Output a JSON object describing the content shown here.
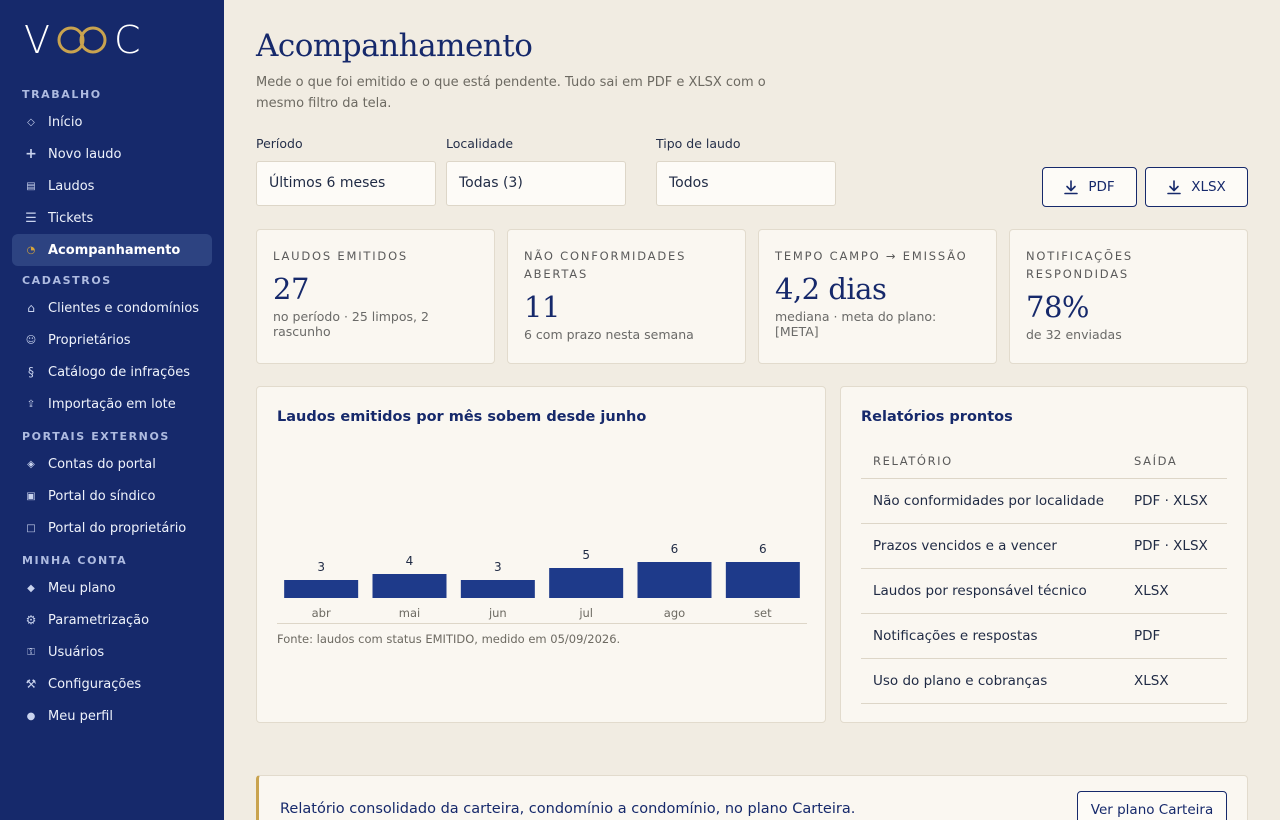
{
  "brand": {
    "logo_text_left": "V",
    "logo_text_right": "C"
  },
  "colors": {
    "navy": "#16296b",
    "gold": "#c9a34f",
    "bar": "#1e3a8a",
    "background": "#f1ece2",
    "card": "#faf7f1"
  },
  "sidebar": {
    "sections": [
      {
        "title": "TRABALHO",
        "items": [
          {
            "label": "Início",
            "icon": "home-diamond-icon"
          },
          {
            "label": "Novo laudo",
            "icon": "plus-icon"
          },
          {
            "label": "Laudos",
            "icon": "document-list-icon"
          },
          {
            "label": "Tickets",
            "icon": "lines-icon"
          },
          {
            "label": "Acompanhamento",
            "icon": "chart-pie-icon",
            "active": true
          }
        ]
      },
      {
        "title": "CADASTROS",
        "items": [
          {
            "label": "Clientes e condomínios",
            "icon": "house-icon"
          },
          {
            "label": "Proprietários",
            "icon": "person-icon"
          },
          {
            "label": "Catálogo de infrações",
            "icon": "section-icon"
          },
          {
            "label": "Importação em lote",
            "icon": "upload-icon"
          }
        ]
      },
      {
        "title": "PORTAIS EXTERNOS",
        "items": [
          {
            "label": "Contas do portal",
            "icon": "diamond-icon"
          },
          {
            "label": "Portal do síndico",
            "icon": "square-filled-icon"
          },
          {
            "label": "Portal do proprietário",
            "icon": "square-outline-icon"
          }
        ]
      },
      {
        "title": "MINHA CONTA",
        "items": [
          {
            "label": "Meu plano",
            "icon": "diamond-solid-icon"
          },
          {
            "label": "Parametrização",
            "icon": "gear-icon"
          },
          {
            "label": "Usuários",
            "icon": "users-icon"
          },
          {
            "label": "Configurações",
            "icon": "tools-icon"
          },
          {
            "label": "Meu perfil",
            "icon": "profile-dot-icon"
          }
        ]
      }
    ]
  },
  "header": {
    "title": "Acompanhamento",
    "subtitle": "Mede o que foi emitido e o que está pendente. Tudo sai em PDF e XLSX com o mesmo filtro da tela."
  },
  "filters": {
    "periodo": {
      "label": "Período",
      "value": "Últimos 6 meses"
    },
    "localidade": {
      "label": "Localidade",
      "value": "Todas (3)"
    },
    "tipo": {
      "label": "Tipo de laudo",
      "value": "Todos"
    }
  },
  "export": {
    "pdf_label": "PDF",
    "xlsx_label": "XLSX"
  },
  "kpis": [
    {
      "label": "Laudos emitidos",
      "value": "27",
      "note": "no período · 25 limpos, 2 rascunho"
    },
    {
      "label": "Não conformidades abertas",
      "value": "11",
      "note": "6 com prazo nesta semana"
    },
    {
      "label": "Tempo campo → emissão",
      "value": "4,2 dias",
      "note": "mediana · meta do plano: [META]"
    },
    {
      "label": "Notificações respondidas",
      "value": "78%",
      "note": "de 32 enviadas"
    }
  ],
  "chart_panel": {
    "title": "Laudos emitidos por mês sobem desde junho",
    "source": "Fonte: laudos com status EMITIDO, medido em 05/09/2026."
  },
  "chart_data": {
    "type": "bar",
    "title": "Laudos emitidos por mês sobem desde junho",
    "categories": [
      "abr",
      "mai",
      "jun",
      "jul",
      "ago",
      "set"
    ],
    "values": [
      3,
      4,
      3,
      5,
      6,
      6
    ],
    "xlabel": "",
    "ylabel": "",
    "ylim": [
      0,
      6
    ],
    "grid": false,
    "data_labels": true
  },
  "reports_panel": {
    "title": "Relatórios prontos",
    "columns": [
      "Relatório",
      "Saída"
    ],
    "rows": [
      [
        "Não conformidades por localidade",
        "PDF · XLSX"
      ],
      [
        "Prazos vencidos e a vencer",
        "PDF · XLSX"
      ],
      [
        "Laudos por responsável técnico",
        "XLSX"
      ],
      [
        "Notificações e respostas",
        "PDF"
      ],
      [
        "Uso do plano e cobranças",
        "XLSX"
      ]
    ]
  },
  "banner": {
    "text": "Relatório consolidado da carteira, condomínio a condomínio, no plano Carteira.",
    "button_label": "Ver plano Carteira"
  }
}
